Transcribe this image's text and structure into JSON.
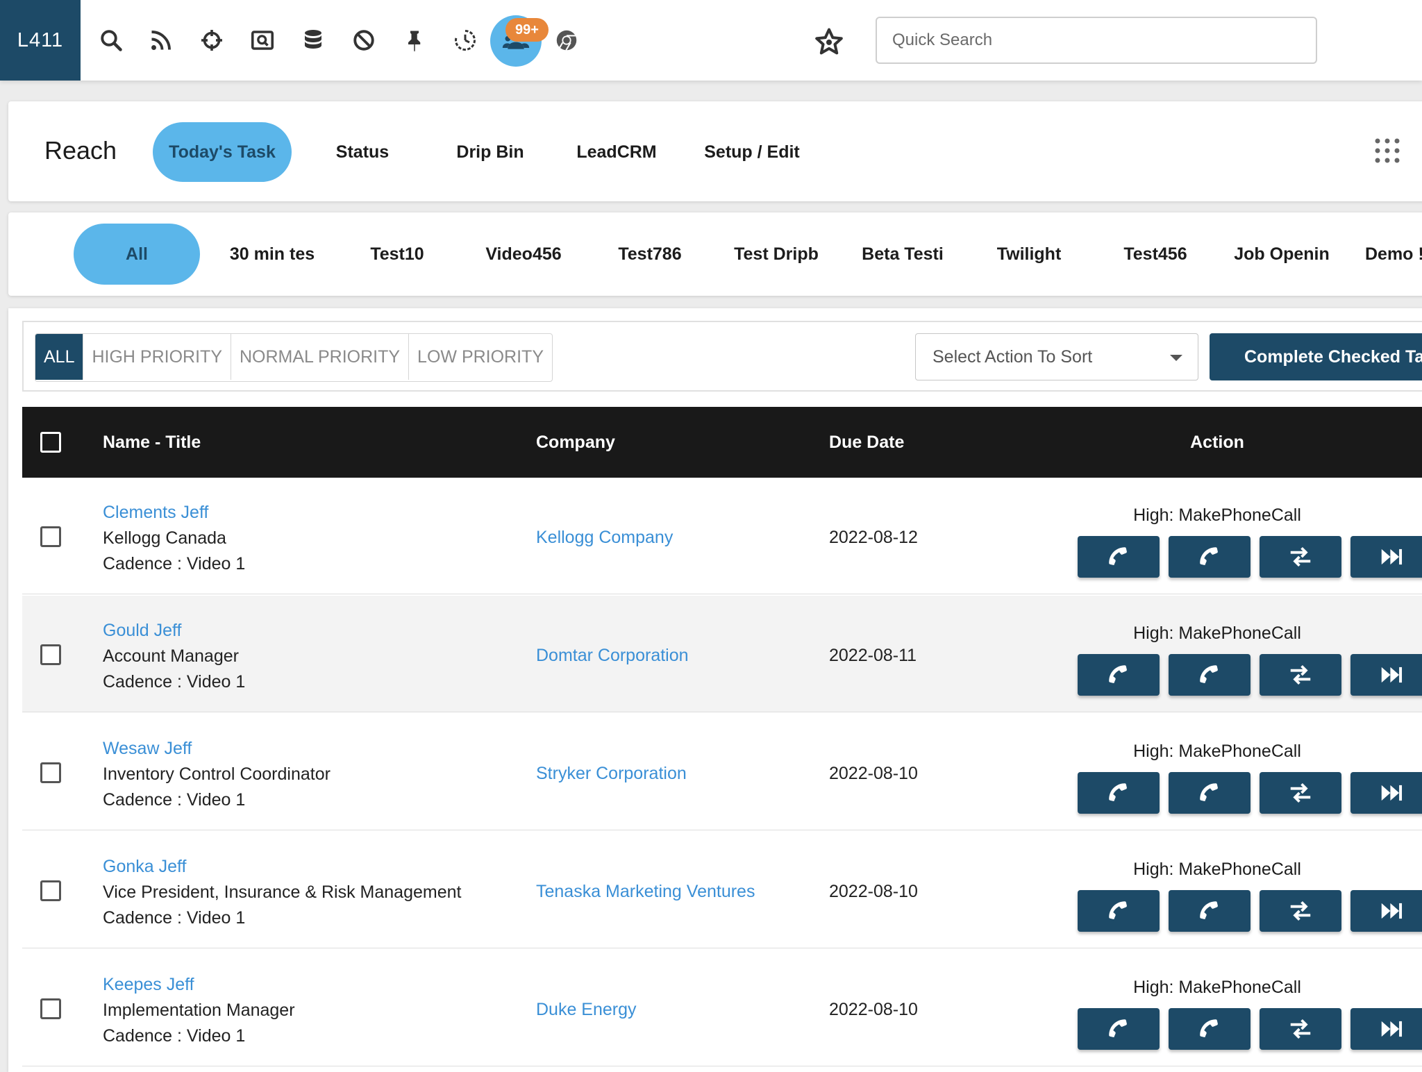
{
  "header": {
    "logo": "L411",
    "badge": "99+",
    "icons": [
      "search-icon",
      "rss-icon",
      "crosshair-icon",
      "screen-search-icon",
      "database-icon",
      "block-icon",
      "pin-icon",
      "history-icon",
      "team-icon",
      "chrome-icon",
      "star-icon"
    ],
    "search_placeholder": "Quick Search"
  },
  "nav": {
    "title": "Reach",
    "tabs": [
      "Today's Task",
      "Status",
      "Drip Bin",
      "LeadCRM",
      "Setup / Edit"
    ]
  },
  "cadences": [
    "All",
    "30 min tes",
    "Test10",
    "Video456",
    "Test786",
    "Test Dripb",
    "Beta Testi",
    "Twilight",
    "Test456",
    "Job Openin",
    "Demo !"
  ],
  "filters": {
    "priorities": [
      "ALL",
      "HIGH PRIORITY",
      "NORMAL PRIORITY",
      "LOW PRIORITY"
    ],
    "sort_placeholder": "Select Action To Sort",
    "complete_label": "Complete Checked Ta"
  },
  "table": {
    "headers": {
      "name": "Name - Title",
      "company": "Company",
      "due": "Due Date",
      "action": "Action"
    },
    "rows": [
      {
        "name": "Clements Jeff",
        "title": "Kellogg Canada",
        "cadence": "Cadence : Video 1",
        "company": "Kellogg Company",
        "due": "2022-08-12",
        "action": "High: MakePhoneCall"
      },
      {
        "name": "Gould Jeff",
        "title": "Account Manager",
        "cadence": "Cadence : Video 1",
        "company": "Domtar Corporation",
        "due": "2022-08-11",
        "action": "High: MakePhoneCall"
      },
      {
        "name": "Wesaw Jeff",
        "title": "Inventory Control Coordinator",
        "cadence": "Cadence : Video 1",
        "company": "Stryker Corporation",
        "due": "2022-08-10",
        "action": "High: MakePhoneCall"
      },
      {
        "name": "Gonka Jeff",
        "title": "Vice President, Insurance & Risk Management",
        "cadence": "Cadence : Video 1",
        "company": "Tenaska Marketing Ventures",
        "due": "2022-08-10",
        "action": "High: MakePhoneCall"
      },
      {
        "name": "Keepes Jeff",
        "title": "Implementation Manager",
        "cadence": "Cadence : Video 1",
        "company": "Duke Energy",
        "due": "2022-08-10",
        "action": "High: MakePhoneCall"
      }
    ]
  },
  "colors": {
    "primary": "#1d4a67",
    "accent": "#5bb6ea",
    "link": "#3a8fd6",
    "badge": "#e8873a"
  }
}
